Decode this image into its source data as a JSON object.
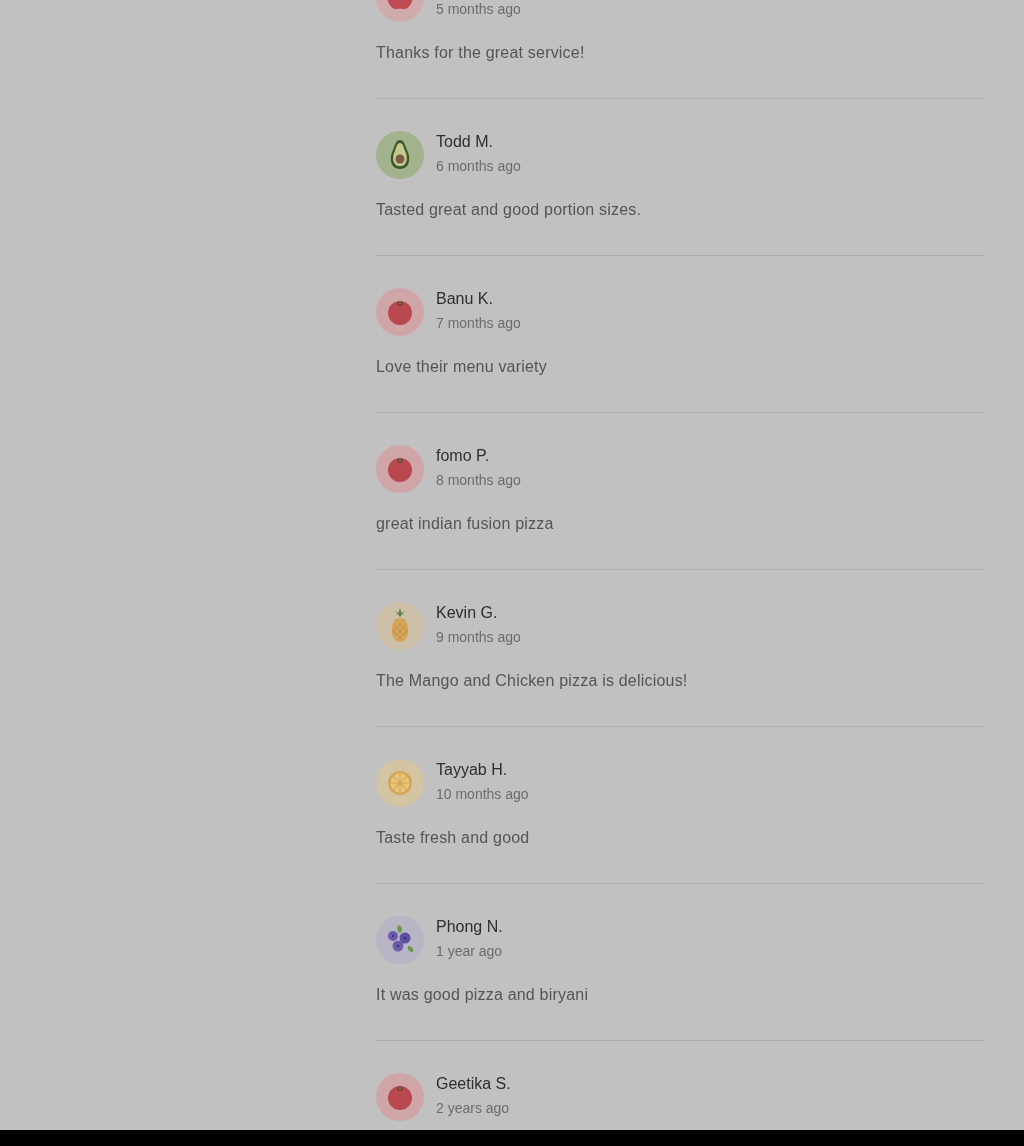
{
  "reviews": [
    {
      "avatar": {
        "kind": "apple"
      },
      "time": "5 months ago",
      "comment": "Thanks for the great service!"
    },
    {
      "avatar": {
        "kind": "avocado"
      },
      "name": "Todd M.",
      "time": "6 months ago",
      "comment": "Tasted great and good portion sizes."
    },
    {
      "avatar": {
        "kind": "tomato"
      },
      "name": "Banu K.",
      "time": "7 months ago",
      "comment": "Love their menu variety"
    },
    {
      "avatar": {
        "kind": "tomato"
      },
      "name": "fomo P.",
      "time": "8 months ago",
      "comment": "great indian fusion pizza"
    },
    {
      "avatar": {
        "kind": "pineapple"
      },
      "name": "Kevin G.",
      "time": "9 months ago",
      "comment": "The Mango and Chicken pizza is delicious!"
    },
    {
      "avatar": {
        "kind": "citrus"
      },
      "name": "Tayyab H.",
      "time": "10 months ago",
      "comment": "Taste fresh and good"
    },
    {
      "avatar": {
        "kind": "berries"
      },
      "name": "Phong N.",
      "time": "1 year ago",
      "comment": "It was good pizza and biryani"
    },
    {
      "avatar": {
        "kind": "tomato"
      },
      "name": "Geetika S.",
      "time": "2 years ago"
    }
  ]
}
